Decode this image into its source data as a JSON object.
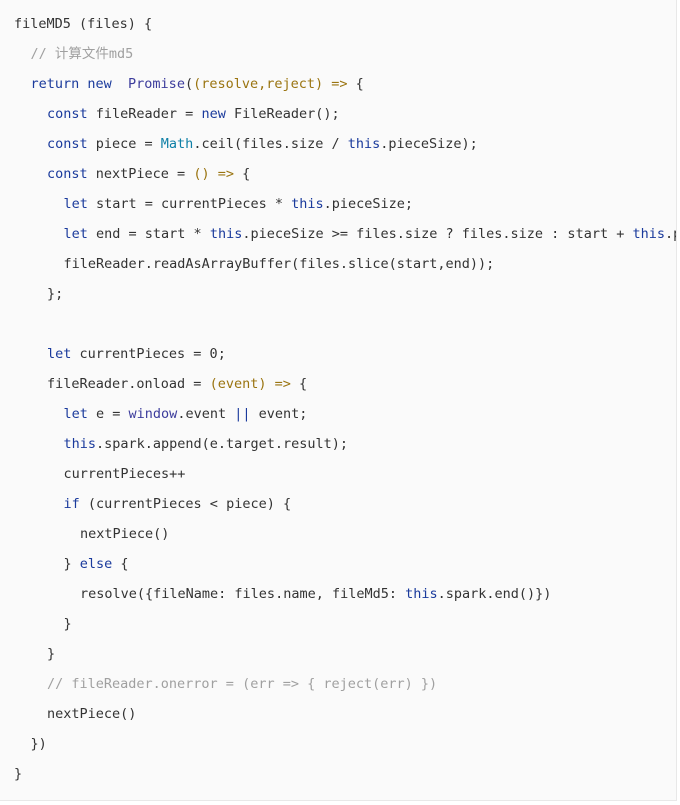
{
  "code": {
    "language": "javascript",
    "colors": {
      "keyword": "#1a3a9c",
      "builtin": "#0d7fa6",
      "param": "#9a7410",
      "comment": "#a0a0a0",
      "text": "#333333",
      "background": "#fafafa"
    },
    "lines": [
      {
        "indent": 0,
        "tokens": [
          [
            "tx",
            "fileMD5 (files) {"
          ]
        ]
      },
      {
        "indent": 1,
        "tokens": [
          [
            "cm",
            "// 计算文件md5"
          ]
        ]
      },
      {
        "indent": 1,
        "tokens": [
          [
            "kw",
            "return new  "
          ],
          [
            "cls",
            "Promise"
          ],
          [
            "tx",
            "("
          ],
          [
            "pa",
            "(resolve,reject) =>"
          ],
          [
            "tx",
            " {"
          ]
        ]
      },
      {
        "indent": 2,
        "tokens": [
          [
            "kw",
            "const"
          ],
          [
            "tx",
            " fileReader = "
          ],
          [
            "kw",
            "new"
          ],
          [
            "tx",
            " FileReader();"
          ]
        ]
      },
      {
        "indent": 2,
        "tokens": [
          [
            "kw",
            "const"
          ],
          [
            "tx",
            " piece = "
          ],
          [
            "bi",
            "Math"
          ],
          [
            "tx",
            ".ceil(files.size / "
          ],
          [
            "kw",
            "this"
          ],
          [
            "tx",
            ".pieceSize);"
          ]
        ]
      },
      {
        "indent": 2,
        "tokens": [
          [
            "kw",
            "const"
          ],
          [
            "tx",
            " nextPiece = "
          ],
          [
            "pa",
            "() =>"
          ],
          [
            "tx",
            " {"
          ]
        ]
      },
      {
        "indent": 3,
        "tokens": [
          [
            "kw",
            "let"
          ],
          [
            "tx",
            " start = currentPieces * "
          ],
          [
            "kw",
            "this"
          ],
          [
            "tx",
            ".pieceSize;"
          ]
        ]
      },
      {
        "indent": 3,
        "tokens": [
          [
            "kw",
            "let"
          ],
          [
            "tx",
            " end = start * "
          ],
          [
            "kw",
            "this"
          ],
          [
            "tx",
            ".pieceSize >= files.size ? files.size : start + "
          ],
          [
            "kw",
            "this"
          ],
          [
            "tx",
            ".pieceSize;"
          ]
        ]
      },
      {
        "indent": 3,
        "tokens": [
          [
            "tx",
            "fileReader.readAsArrayBuffer(files.slice(start,end));"
          ]
        ]
      },
      {
        "indent": 2,
        "tokens": [
          [
            "tx",
            "};"
          ]
        ]
      },
      {
        "indent": 0,
        "tokens": [
          [
            "tx",
            ""
          ]
        ]
      },
      {
        "indent": 2,
        "tokens": [
          [
            "kw",
            "let"
          ],
          [
            "tx",
            " currentPieces = 0;"
          ]
        ]
      },
      {
        "indent": 2,
        "tokens": [
          [
            "tx",
            "fileReader.onload = "
          ],
          [
            "pa",
            "(event) =>"
          ],
          [
            "tx",
            " {"
          ]
        ]
      },
      {
        "indent": 3,
        "tokens": [
          [
            "kw",
            "let"
          ],
          [
            "tx",
            " e = "
          ],
          [
            "cls",
            "window"
          ],
          [
            "tx",
            ".event "
          ],
          [
            "kw",
            "||"
          ],
          [
            "tx",
            " event;"
          ]
        ]
      },
      {
        "indent": 3,
        "tokens": [
          [
            "kw",
            "this"
          ],
          [
            "tx",
            ".spark.append(e.target.result);"
          ]
        ]
      },
      {
        "indent": 3,
        "tokens": [
          [
            "tx",
            "currentPieces++"
          ]
        ]
      },
      {
        "indent": 3,
        "tokens": [
          [
            "kw",
            "if"
          ],
          [
            "tx",
            " (currentPieces < piece) {"
          ]
        ]
      },
      {
        "indent": 4,
        "tokens": [
          [
            "tx",
            "nextPiece()"
          ]
        ]
      },
      {
        "indent": 3,
        "tokens": [
          [
            "tx",
            "} "
          ],
          [
            "kw",
            "else"
          ],
          [
            "tx",
            " {"
          ]
        ]
      },
      {
        "indent": 4,
        "tokens": [
          [
            "tx",
            "resolve({fileName: files.name, fileMd5: "
          ],
          [
            "kw",
            "this"
          ],
          [
            "tx",
            ".spark.end()})"
          ]
        ]
      },
      {
        "indent": 3,
        "tokens": [
          [
            "tx",
            "}"
          ]
        ]
      },
      {
        "indent": 2,
        "tokens": [
          [
            "tx",
            "}"
          ]
        ]
      },
      {
        "indent": 2,
        "tokens": [
          [
            "cm",
            "// fileReader.onerror = (err => { reject(err) })"
          ]
        ]
      },
      {
        "indent": 2,
        "tokens": [
          [
            "tx",
            "nextPiece()"
          ]
        ]
      },
      {
        "indent": 1,
        "tokens": [
          [
            "tx",
            "})"
          ]
        ]
      },
      {
        "indent": 0,
        "tokens": [
          [
            "tx",
            "}"
          ]
        ]
      }
    ]
  }
}
